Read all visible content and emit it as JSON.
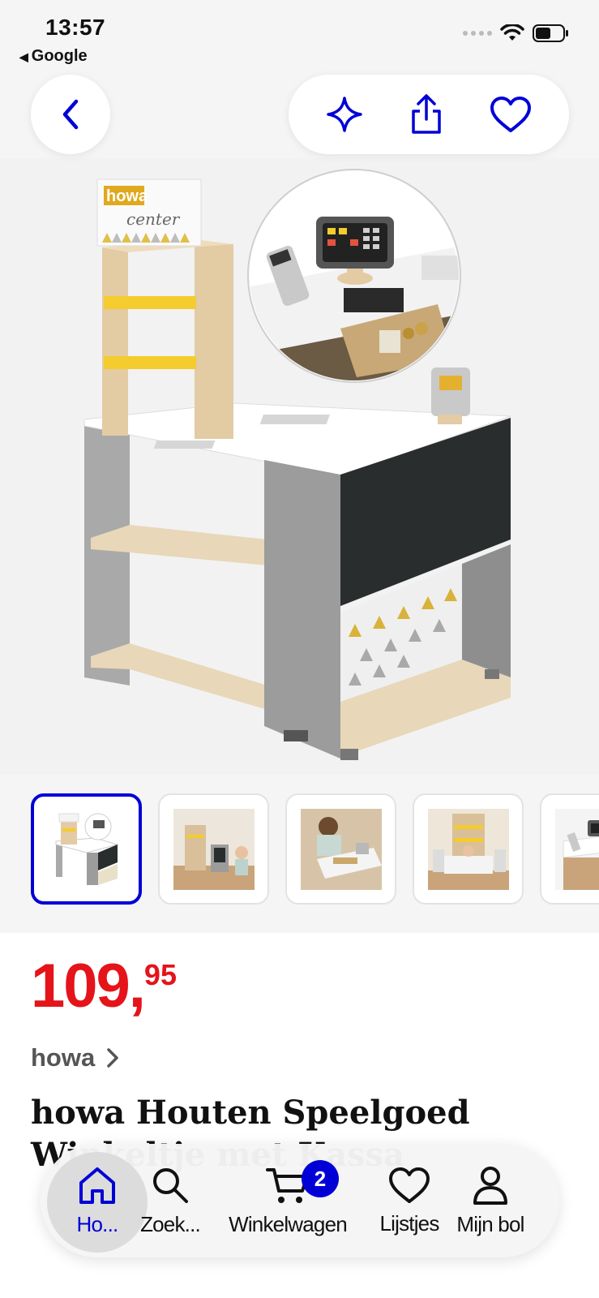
{
  "status_bar": {
    "time": "13:57",
    "back_app": "Google"
  },
  "product": {
    "price_main": "109,",
    "price_cents": "95",
    "brand": "howa",
    "title": "howa Houten Speelgoed Winkeltje met Kassa"
  },
  "images": {
    "thumbnail_count": 5,
    "selected_index": 0
  },
  "tabbar": {
    "home": "Ho...",
    "search": "Zoek...",
    "cart": "Winkelwagen",
    "cart_badge": "2",
    "lists": "Lijstjes",
    "mybol": "Mijn bol"
  },
  "colors": {
    "accent": "#0000d6",
    "price": "#e4141a"
  }
}
